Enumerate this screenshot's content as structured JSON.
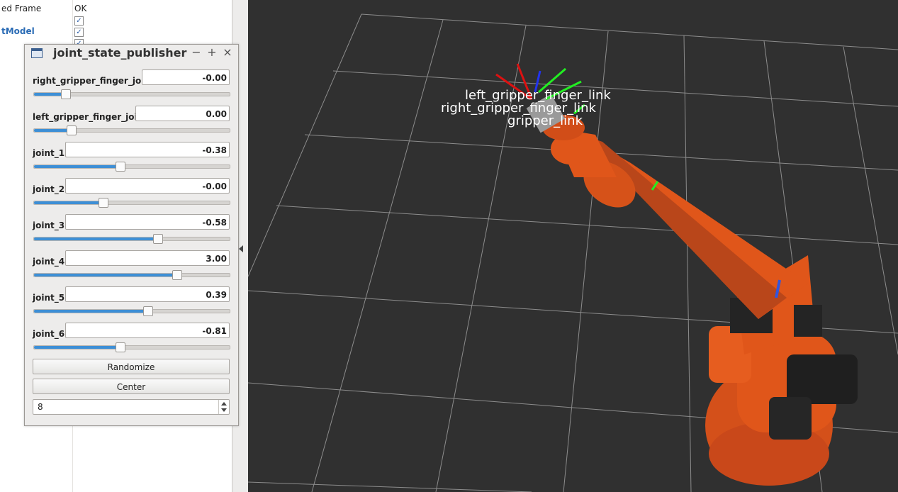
{
  "properties": {
    "rows": [
      {
        "name": "ed Frame",
        "value": "OK"
      },
      {
        "name": "tModel",
        "value": ""
      }
    ]
  },
  "jsp": {
    "title": "joint_state_publisher",
    "minimize": "−",
    "maximize": "+",
    "close": "×",
    "joints": [
      {
        "name": "right_gripper_finger_joint",
        "value": "-0.00",
        "level": 0.16
      },
      {
        "name": "left_gripper_finger_joint",
        "value": "0.00",
        "level": 0.19
      },
      {
        "name": "joint_1",
        "value": "-0.38",
        "level": 0.44
      },
      {
        "name": "joint_2",
        "value": "-0.00",
        "level": 0.35
      },
      {
        "name": "joint_3",
        "value": "-0.58",
        "level": 0.63
      },
      {
        "name": "joint_4",
        "value": "3.00",
        "level": 0.73
      },
      {
        "name": "joint_5",
        "value": "0.39",
        "level": 0.58
      },
      {
        "name": "joint_6",
        "value": "-0.81",
        "level": 0.44
      }
    ],
    "randomize_label": "Randomize",
    "center_label": "Center",
    "spin_value": "8"
  },
  "view": {
    "tf_labels": [
      "left_gripper_finger_link",
      "right_gripper_finger_link",
      "gripper_link"
    ],
    "background": "#303030",
    "robot_color": "#e0561a"
  }
}
